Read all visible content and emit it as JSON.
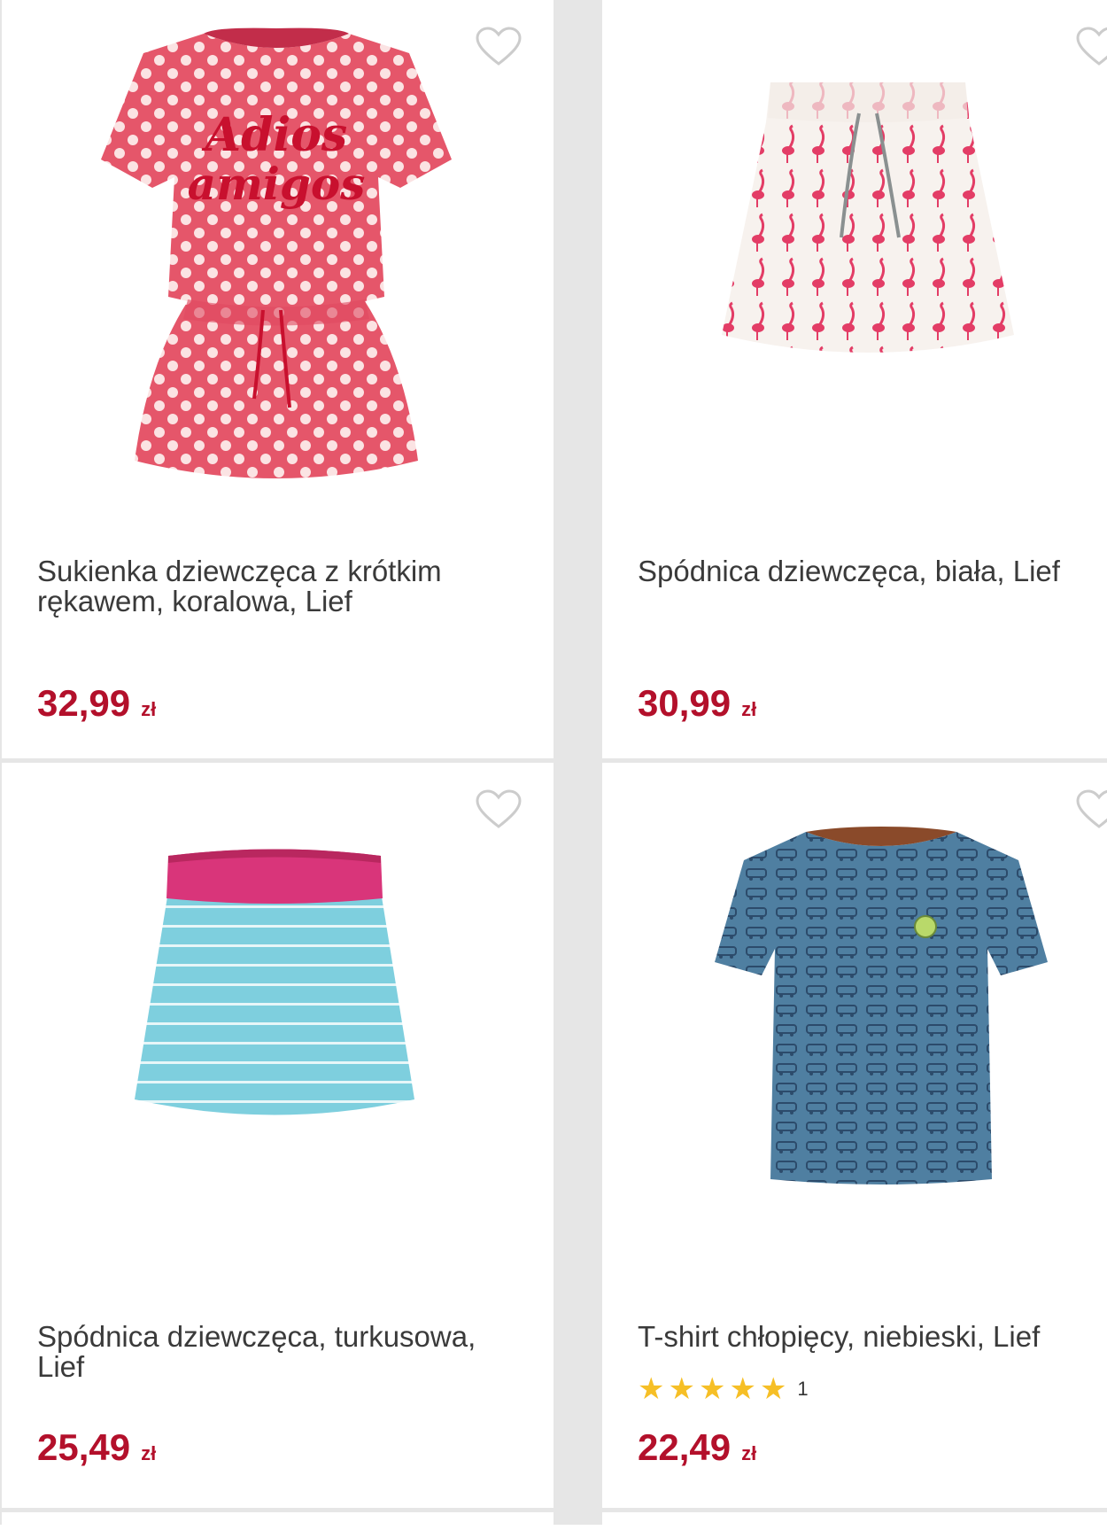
{
  "products": [
    {
      "title": "Sukienka dziewczęca z krótkim rękawem, koralowa, Lief",
      "price": "32,99",
      "currency": "zł",
      "image": "dress-image",
      "colors": {
        "main": "#e5566a",
        "accent": "#c8102e"
      }
    },
    {
      "title": "Spódnica dziewczęca, biała, Lief",
      "price": "30,99",
      "currency": "zł",
      "image": "skirt-image",
      "colors": {
        "main": "#f7f2ee",
        "accent": "#e33d66"
      }
    },
    {
      "title": "Spódnica dziewczęca, turkusowa, Lief",
      "price": "25,49",
      "currency": "zł",
      "image": "skirt-image",
      "colors": {
        "main": "#7ecfde",
        "accent": "#d9357a"
      }
    },
    {
      "title": "T-shirt chłopięcy, niebieski, Lief",
      "price": "22,49",
      "currency": "zł",
      "image": "tshirt-image",
      "rating_count": "1",
      "rating": 5,
      "colors": {
        "main": "#4f7fa1",
        "accent": "#2c4b6b"
      }
    }
  ],
  "theme": {
    "price_color": "#b3102b",
    "star_color": "#f6bf26",
    "heart_color": "#cccccc"
  }
}
